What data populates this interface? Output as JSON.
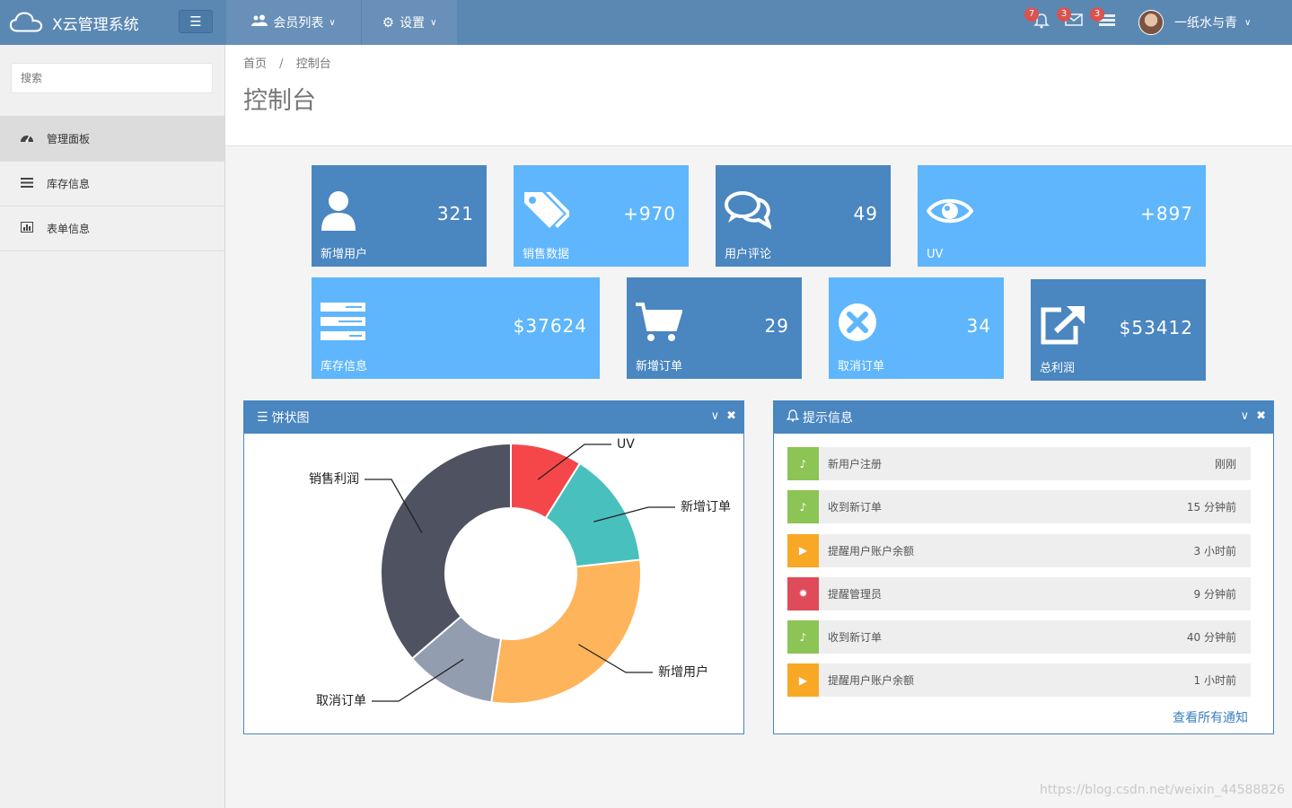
{
  "brand": {
    "title": "X云管理系统"
  },
  "topnav": {
    "members_label": "会员列表",
    "settings_label": "设置"
  },
  "top_icons": {
    "notifications_badge": "7",
    "messages_badge": "3",
    "tasks_badge": "3"
  },
  "user": {
    "name": "一纸水与青"
  },
  "sidebar": {
    "search_placeholder": "搜索",
    "items": [
      {
        "label": "管理面板",
        "icon": "dashboard-icon",
        "active": true
      },
      {
        "label": "库存信息",
        "icon": "list-icon",
        "active": false
      },
      {
        "label": "表单信息",
        "icon": "bar-chart-icon",
        "active": false
      }
    ]
  },
  "breadcrumb": {
    "home": "首页",
    "separator": "/",
    "current": "控制台"
  },
  "page_title": "控制台",
  "tiles": [
    {
      "value": "321",
      "label": "新增用户",
      "icon": "user-icon"
    },
    {
      "value": "+970",
      "label": "销售数据",
      "icon": "tags-icon"
    },
    {
      "value": "49",
      "label": "用户评论",
      "icon": "comments-icon"
    },
    {
      "value": "+897",
      "label": "UV",
      "icon": "eye-icon"
    },
    {
      "value": "$37624",
      "label": "库存信息",
      "icon": "tasks-icon"
    },
    {
      "value": "29",
      "label": "新增订单",
      "icon": "cart-icon"
    },
    {
      "value": "34",
      "label": "取消订单",
      "icon": "cancel-icon"
    },
    {
      "value": "$53412",
      "label": "总利润",
      "icon": "external-link-icon"
    }
  ],
  "pie_panel": {
    "title": "饼状图"
  },
  "chart_data": {
    "type": "pie",
    "categories": [
      "UV",
      "新增订单",
      "新增用户",
      "取消订单",
      "销售利润"
    ],
    "values": [
      8.9,
      14.4,
      29.1,
      11.3,
      36.3
    ],
    "colors": [
      "#f5474a",
      "#48c0bd",
      "#feb45b",
      "#939db0",
      "#4f5261"
    ]
  },
  "notice_panel": {
    "title": "提示信息",
    "items": [
      {
        "text": "新用户注册",
        "time": "刚刚",
        "icon": "bell-icon",
        "color": "#8dc456"
      },
      {
        "text": "收到新订单",
        "time": "15 分钟前",
        "icon": "bell-icon",
        "color": "#8dc456"
      },
      {
        "text": "提醒用户账户余额",
        "time": "3 小时前",
        "icon": "bullhorn-icon",
        "color": "#f9a826"
      },
      {
        "text": "提醒管理员",
        "time": "9 分钟前",
        "icon": "bug-icon",
        "color": "#e04b5a"
      },
      {
        "text": "收到新订单",
        "time": "40 分钟前",
        "icon": "bell-icon",
        "color": "#8dc456"
      },
      {
        "text": "提醒用户账户余额",
        "time": "1 小时前",
        "icon": "bullhorn-icon",
        "color": "#f9a826"
      }
    ],
    "more_label": "查看所有通知"
  },
  "watermark": "https://blog.csdn.net/weixin_44588826"
}
